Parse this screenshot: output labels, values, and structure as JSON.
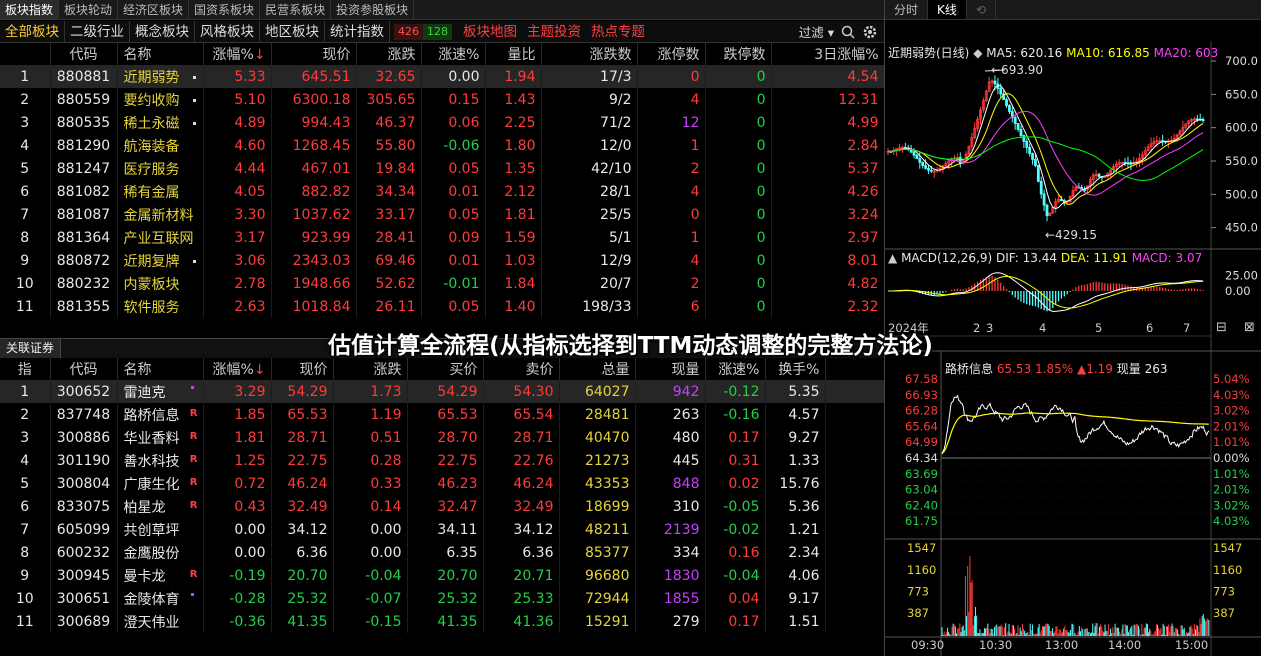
{
  "top_tabs": [
    "板块指数",
    "板块轮动",
    "经济区板块",
    "国资系板块",
    "民营系板块",
    "投资参股板块"
  ],
  "second_tabs": [
    "全部板块",
    "二级行业",
    "概念板块",
    "风格板块",
    "地区板块",
    "统计指数"
  ],
  "badge_up": "426",
  "badge_down": "128",
  "red_tabs": [
    "板块地图",
    "主题投资",
    "热点专题"
  ],
  "filter_label": "过滤",
  "sector_table": {
    "headers": [
      "代码",
      "名称",
      "涨幅%",
      "现价",
      "涨跌",
      "涨速%",
      "量比",
      "涨跌数",
      "涨停数",
      "跌停数",
      "3日涨幅%"
    ],
    "sort_arrow": "↓",
    "rows": [
      {
        "no": "1",
        "code": "880881",
        "name": "近期弱势",
        "chg": "5.33",
        "price": "645.51",
        "diff": "32.65",
        "speed": "0.00",
        "vr": "1.94",
        "ud": "17/3",
        "lu": "0",
        "ld": "0",
        "d3": "4.54"
      },
      {
        "no": "2",
        "code": "880559",
        "name": "要约收购",
        "chg": "5.10",
        "price": "6300.18",
        "diff": "305.65",
        "speed": "0.15",
        "vr": "1.43",
        "ud": "9/2",
        "lu": "4",
        "ld": "0",
        "d3": "12.31"
      },
      {
        "no": "3",
        "code": "880535",
        "name": "稀土永磁",
        "chg": "4.89",
        "price": "994.43",
        "diff": "46.37",
        "speed": "0.06",
        "vr": "2.25",
        "ud": "71/2",
        "lu": "12",
        "ld": "0",
        "d3": "4.99"
      },
      {
        "no": "4",
        "code": "881290",
        "name": "航海装备",
        "chg": "4.60",
        "price": "1268.45",
        "diff": "55.80",
        "speed": "-0.06",
        "vr": "1.80",
        "ud": "12/0",
        "lu": "1",
        "ld": "0",
        "d3": "2.84"
      },
      {
        "no": "5",
        "code": "881247",
        "name": "医疗服务",
        "chg": "4.44",
        "price": "467.01",
        "diff": "19.84",
        "speed": "0.05",
        "vr": "1.35",
        "ud": "42/10",
        "lu": "2",
        "ld": "0",
        "d3": "5.37"
      },
      {
        "no": "6",
        "code": "881082",
        "name": "稀有金属",
        "chg": "4.05",
        "price": "882.82",
        "diff": "34.34",
        "speed": "0.01",
        "vr": "2.12",
        "ud": "28/1",
        "lu": "4",
        "ld": "0",
        "d3": "4.26"
      },
      {
        "no": "7",
        "code": "881087",
        "name": "金属新材料",
        "chg": "3.30",
        "price": "1037.62",
        "diff": "33.17",
        "speed": "0.05",
        "vr": "1.81",
        "ud": "25/5",
        "lu": "0",
        "ld": "0",
        "d3": "3.24"
      },
      {
        "no": "8",
        "code": "881364",
        "name": "产业互联网",
        "chg": "3.17",
        "price": "923.99",
        "diff": "28.41",
        "speed": "0.09",
        "vr": "1.59",
        "ud": "5/1",
        "lu": "1",
        "ld": "0",
        "d3": "2.97"
      },
      {
        "no": "9",
        "code": "880872",
        "name": "近期复牌",
        "chg": "3.06",
        "price": "2343.03",
        "diff": "69.46",
        "speed": "0.01",
        "vr": "1.03",
        "ud": "12/9",
        "lu": "4",
        "ld": "0",
        "d3": "8.01"
      },
      {
        "no": "10",
        "code": "880232",
        "name": "内蒙板块",
        "chg": "2.78",
        "price": "1948.66",
        "diff": "52.62",
        "speed": "-0.01",
        "vr": "1.84",
        "ud": "20/7",
        "lu": "2",
        "ld": "0",
        "d3": "4.82"
      },
      {
        "no": "11",
        "code": "881355",
        "name": "软件服务",
        "chg": "2.63",
        "price": "1018.84",
        "diff": "26.11",
        "speed": "0.05",
        "vr": "1.40",
        "ud": "198/33",
        "lu": "6",
        "ld": "0",
        "d3": "2.32"
      }
    ]
  },
  "stock_section_tab": "关联证券",
  "stock_table": {
    "headers": [
      "指",
      "代码",
      "名称",
      "涨幅%",
      "现价",
      "涨跌",
      "买价",
      "卖价",
      "总量",
      "现量",
      "涨速%",
      "换手%"
    ],
    "sort_arrow": "↓",
    "rows": [
      {
        "no": "1",
        "code": "300652",
        "name": "雷迪克",
        "flag": "",
        "chg": "3.29",
        "price": "54.29",
        "diff": "1.73",
        "bid": "54.29",
        "ask": "54.30",
        "vol": "64027",
        "cur": "942",
        "speed": "-0.12",
        "turn": "5.35"
      },
      {
        "no": "2",
        "code": "837748",
        "name": "路桥信息",
        "flag": "R",
        "chg": "1.85",
        "price": "65.53",
        "diff": "1.19",
        "bid": "65.53",
        "ask": "65.54",
        "vol": "28481",
        "cur": "263",
        "speed": "-0.16",
        "turn": "4.57"
      },
      {
        "no": "3",
        "code": "300886",
        "name": "华业香料",
        "flag": "R",
        "chg": "1.81",
        "price": "28.71",
        "diff": "0.51",
        "bid": "28.70",
        "ask": "28.71",
        "vol": "40470",
        "cur": "480",
        "speed": "0.17",
        "turn": "9.27"
      },
      {
        "no": "4",
        "code": "301190",
        "name": "善水科技",
        "flag": "R",
        "chg": "1.25",
        "price": "22.75",
        "diff": "0.28",
        "bid": "22.75",
        "ask": "22.76",
        "vol": "21273",
        "cur": "445",
        "speed": "0.31",
        "turn": "1.33"
      },
      {
        "no": "5",
        "code": "300804",
        "name": "广康生化",
        "flag": "R",
        "chg": "0.72",
        "price": "46.24",
        "diff": "0.33",
        "bid": "46.23",
        "ask": "46.24",
        "vol": "43353",
        "cur": "848",
        "speed": "0.02",
        "turn": "15.76"
      },
      {
        "no": "6",
        "code": "833075",
        "name": "柏星龙",
        "flag": "R",
        "chg": "0.43",
        "price": "32.49",
        "diff": "0.14",
        "bid": "32.47",
        "ask": "32.49",
        "vol": "18699",
        "cur": "310",
        "speed": "-0.05",
        "turn": "5.36"
      },
      {
        "no": "7",
        "code": "605099",
        "name": "共创草坪",
        "flag": "",
        "chg": "0.00",
        "price": "34.12",
        "diff": "0.00",
        "bid": "34.11",
        "ask": "34.12",
        "vol": "48211",
        "cur": "2139",
        "speed": "-0.02",
        "turn": "1.21"
      },
      {
        "no": "8",
        "code": "600232",
        "name": "金鹰股份",
        "flag": "",
        "chg": "0.00",
        "price": "6.36",
        "diff": "0.00",
        "bid": "6.35",
        "ask": "6.36",
        "vol": "85377",
        "cur": "334",
        "speed": "0.16",
        "turn": "2.34"
      },
      {
        "no": "9",
        "code": "300945",
        "name": "曼卡龙",
        "flag": "R",
        "chg": "-0.19",
        "price": "20.70",
        "diff": "-0.04",
        "bid": "20.70",
        "ask": "20.71",
        "vol": "96680",
        "cur": "1830",
        "speed": "-0.04",
        "turn": "4.06"
      },
      {
        "no": "10",
        "code": "300651",
        "name": "金陵体育",
        "flag": "",
        "chg": "-0.28",
        "price": "25.32",
        "diff": "-0.07",
        "bid": "25.32",
        "ask": "25.33",
        "vol": "72944",
        "cur": "1855",
        "speed": "0.04",
        "turn": "9.17"
      },
      {
        "no": "11",
        "code": "300689",
        "name": "澄天伟业",
        "flag": "",
        "chg": "-0.36",
        "price": "41.35",
        "diff": "-0.15",
        "bid": "41.35",
        "ask": "41.36",
        "vol": "15291",
        "cur": "279",
        "speed": "0.17",
        "turn": "1.51"
      }
    ]
  },
  "overlay_title": "估值计算全流程(从指标选择到TTM动态调整的完整方法论)",
  "right_tabs": [
    "分时",
    "K线"
  ],
  "kline": {
    "legend_name": "近期弱势(日线)",
    "ma5": "MA5: 620.16",
    "ma10": "MA10: 616.85",
    "ma20": "MA20: 603",
    "high_label": "693.90",
    "low_label": "429.15",
    "price_ticks": [
      "700.0",
      "650.0",
      "600.0",
      "550.0",
      "500.0",
      "450.0"
    ],
    "colors": {
      "ma5": "#ffffff",
      "ma10": "#ffff00",
      "ma20": "#ff40ff",
      "ma60": "#00ff00",
      "up": "#ff3b3b",
      "down": "#54ffff"
    }
  },
  "macd": {
    "label": "MACD(12,26,9)",
    "dif": "DIF: 13.44",
    "dea": "DEA: 11.91",
    "macd": "MACD: 3.07",
    "ticks": [
      "25.00",
      "0.00"
    ],
    "date_labels": [
      "2024年",
      "2",
      "3",
      "4",
      "5",
      "6",
      "7"
    ]
  },
  "intraday": {
    "legend_name": "路桥信息",
    "price": "65.53",
    "pct": "1.85%",
    "diff": "▲1.19",
    "cur_vol": "现量 263",
    "left_ticks": [
      "67.58",
      "66.93",
      "66.28",
      "65.64",
      "64.99",
      "64.34",
      "63.69",
      "63.04",
      "62.40",
      "61.75"
    ],
    "right_ticks": [
      "5.04%",
      "4.03%",
      "3.02%",
      "2.01%",
      "1.01%",
      "0.00%",
      "1.01%",
      "2.01%",
      "3.02%",
      "4.03%"
    ],
    "vol_ticks": [
      "1547",
      "1160",
      "773",
      "387"
    ],
    "time_labels": [
      "09:30",
      "10:30",
      "13:00",
      "14:00",
      "15:00"
    ]
  }
}
